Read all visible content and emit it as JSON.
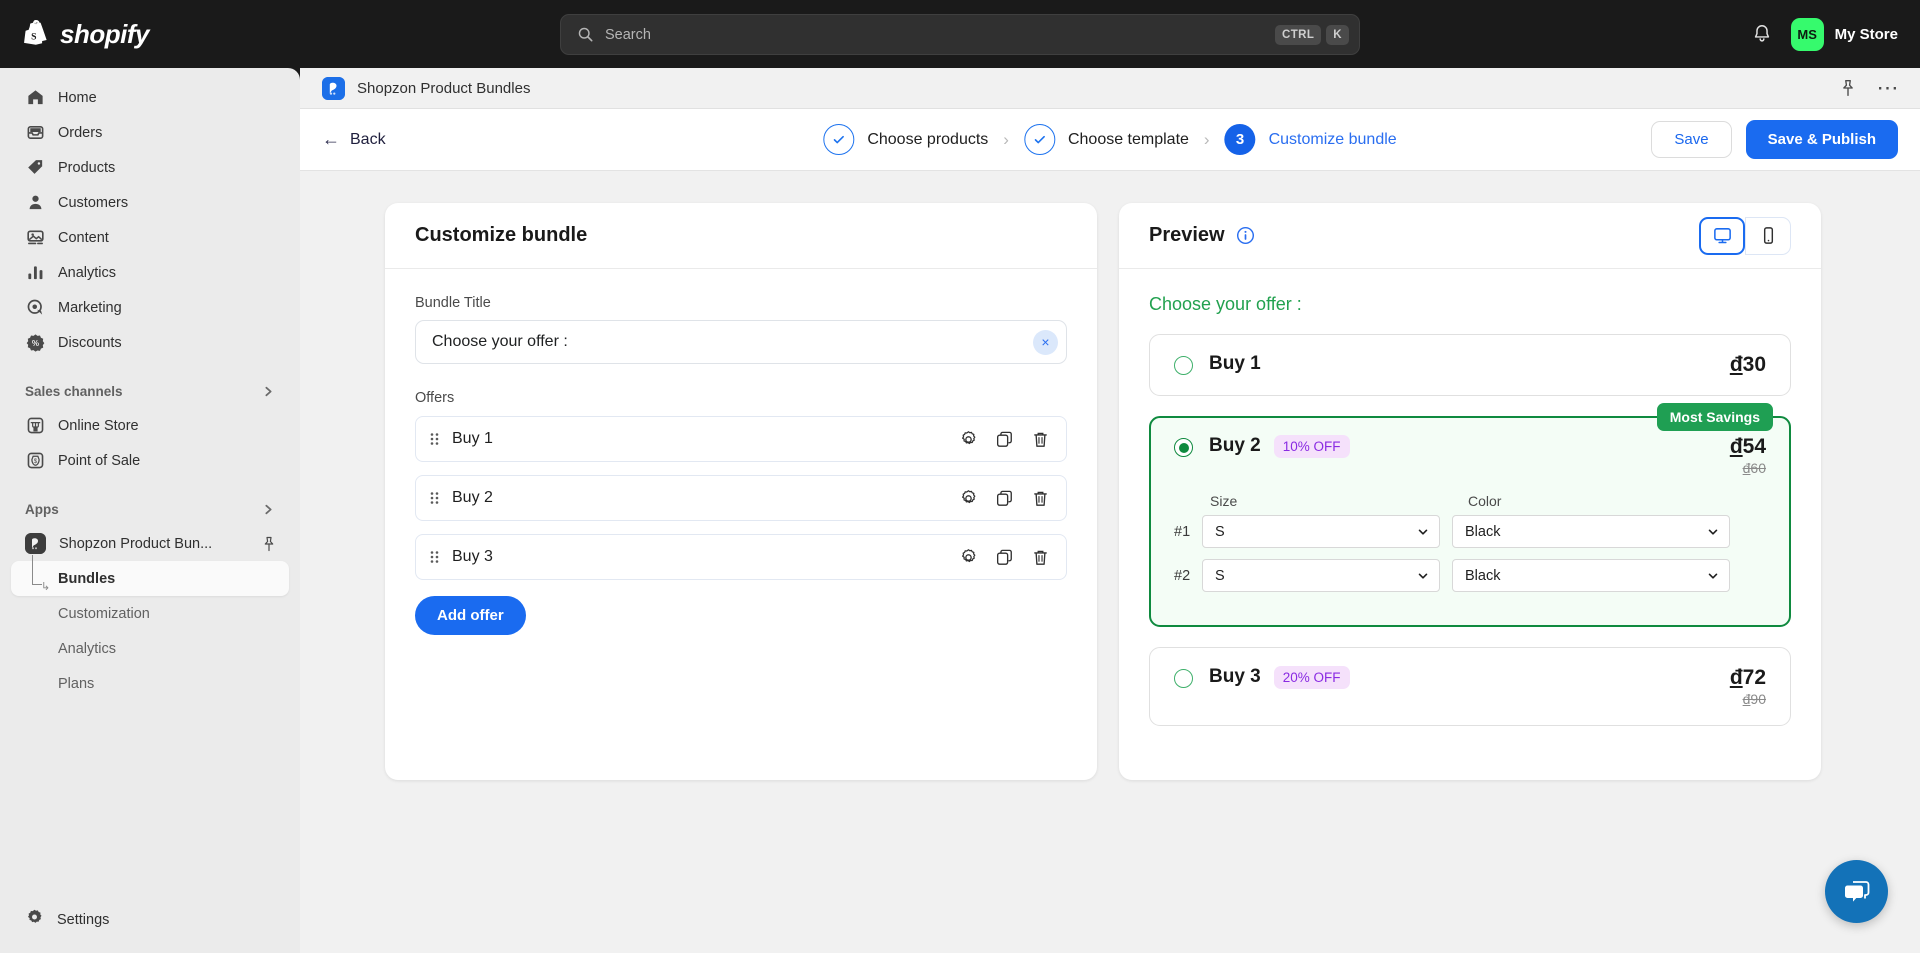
{
  "topbar": {
    "brand": "shopify",
    "search_placeholder": "Search",
    "shortcut_ctrl": "CTRL",
    "shortcut_key": "K",
    "avatar_initials": "MS",
    "store_name": "My Store"
  },
  "sidebar": {
    "items": [
      {
        "label": "Home",
        "icon": "home-icon"
      },
      {
        "label": "Orders",
        "icon": "orders-icon"
      },
      {
        "label": "Products",
        "icon": "products-tag-icon"
      },
      {
        "label": "Customers",
        "icon": "customers-person-icon"
      },
      {
        "label": "Content",
        "icon": "content-image-icon"
      },
      {
        "label": "Analytics",
        "icon": "analytics-bars-icon"
      },
      {
        "label": "Marketing",
        "icon": "marketing-target-icon"
      },
      {
        "label": "Discounts",
        "icon": "discounts-percent-icon"
      }
    ],
    "sales_channels_group": "Sales channels",
    "sales_channels": [
      {
        "label": "Online Store",
        "icon": "store-icon"
      },
      {
        "label": "Point of Sale",
        "icon": "pos-icon"
      }
    ],
    "apps_group": "Apps",
    "app_name": "Shopzon Product Bun...",
    "app_subitems": [
      {
        "label": "Bundles",
        "active": true
      },
      {
        "label": "Customization",
        "active": false
      },
      {
        "label": "Analytics",
        "active": false
      },
      {
        "label": "Plans",
        "active": false
      }
    ],
    "settings_label": "Settings"
  },
  "app_header": {
    "title": "Shopzon Product Bundles",
    "pin_icon": "pin-icon",
    "more_icon": "more-horizontal-icon"
  },
  "stepbar": {
    "back_label": "Back",
    "steps": [
      {
        "marker": "✓",
        "label": "Choose products",
        "state": "done"
      },
      {
        "marker": "✓",
        "label": "Choose template",
        "state": "done"
      },
      {
        "marker": "3",
        "label": "Customize bundle",
        "state": "current"
      }
    ],
    "separator": "›",
    "save_label": "Save",
    "save_publish_label": "Save & Publish"
  },
  "customize": {
    "title": "Customize bundle",
    "bundle_title_label": "Bundle Title",
    "bundle_title_value": "Choose your offer :",
    "bundle_title_placeholder": "Bundle Title",
    "clear_icon": "×",
    "offers_label": "Offers",
    "offers": [
      {
        "name": "Buy 1"
      },
      {
        "name": "Buy 2"
      },
      {
        "name": "Buy 3"
      }
    ],
    "add_offer_label": "Add offer"
  },
  "preview": {
    "title": "Preview",
    "info_icon": "info-circle-icon",
    "device_desktop": "desktop-icon",
    "device_mobile": "mobile-icon",
    "heading": "Choose your offer :",
    "savings_badge": "Most Savings",
    "variant_headers": {
      "size": "Size",
      "color": "Color"
    },
    "offers": [
      {
        "name": "Buy 1",
        "discount": "",
        "price": "30",
        "currency": "đ",
        "compare_at": "",
        "selected": false,
        "variants": []
      },
      {
        "name": "Buy 2",
        "discount": "10% OFF",
        "price": "54",
        "currency": "đ",
        "compare_at": "60",
        "selected": true,
        "badge": "Most Savings",
        "variants": [
          {
            "index": "#1",
            "size": "S",
            "color": "Black"
          },
          {
            "index": "#2",
            "size": "S",
            "color": "Black"
          }
        ]
      },
      {
        "name": "Buy 3",
        "discount": "20% OFF",
        "price": "72",
        "currency": "đ",
        "compare_at": "90",
        "selected": false,
        "variants": []
      }
    ]
  },
  "chat": {
    "icon": "chat-bubble-icon"
  },
  "colors": {
    "accent_blue": "#1a6bf0",
    "green": "#1f9f53",
    "purple_badge_bg": "#f5e1fb",
    "purple_badge_text": "#8a2be2",
    "topbar_bg": "#1a1a1a",
    "sidebar_bg": "#ebebeb"
  }
}
